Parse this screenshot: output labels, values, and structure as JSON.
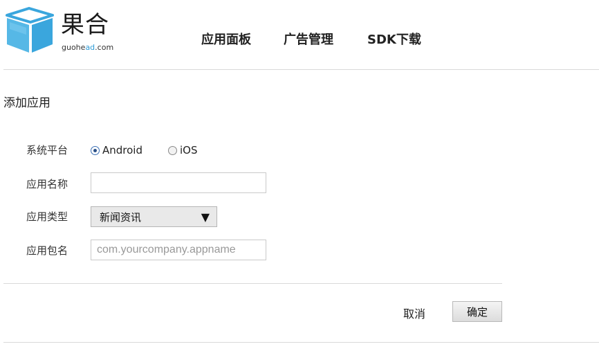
{
  "header": {
    "logo_cn": "果合",
    "logo_en_prefix": "guohe",
    "logo_en_accent": "ad",
    "logo_en_suffix": ".com",
    "nav": [
      "应用面板",
      "广告管理",
      "SDK下载"
    ]
  },
  "page_title": "添加应用",
  "form": {
    "platform_label": "系统平台",
    "platform_options": [
      "Android",
      "iOS"
    ],
    "platform_selected": "Android",
    "app_name_label": "应用名称",
    "app_name_value": "",
    "app_type_label": "应用类型",
    "app_type_value": "新闻资讯",
    "app_type_arrow": "▼",
    "package_label": "应用包名",
    "package_placeholder": "com.yourcompany.appname",
    "package_value": ""
  },
  "actions": {
    "cancel_label": "取消",
    "confirm_label": "确定"
  },
  "colors": {
    "logo_blue": "#3aa6dd",
    "logo_accent": "#2e9bd6"
  },
  "icons": {
    "logo": "cube-logo-icon",
    "radio_selected": "radio-selected-icon",
    "radio_unselected": "radio-unselected-icon",
    "dropdown": "triangle-down-icon"
  }
}
